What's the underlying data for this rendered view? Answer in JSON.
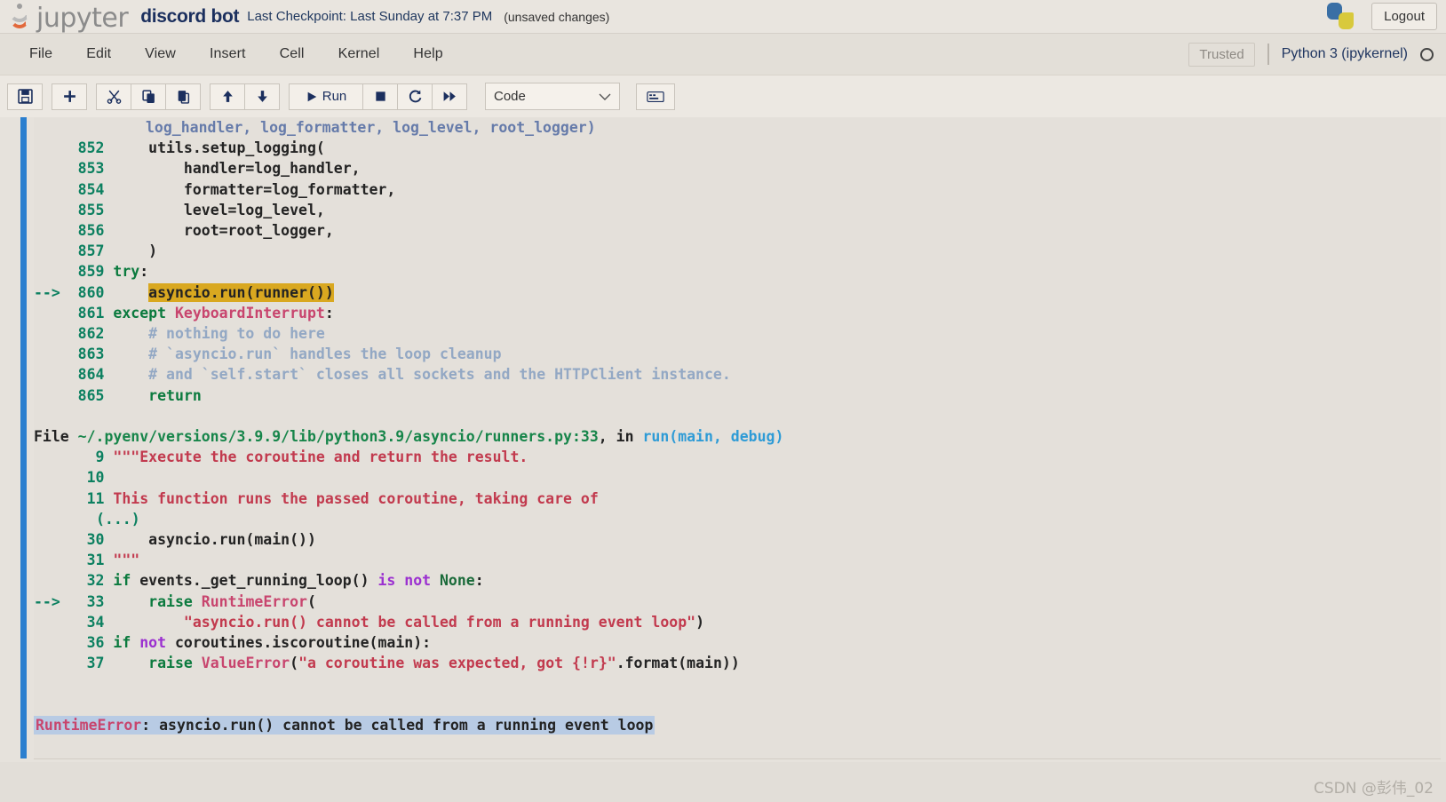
{
  "header": {
    "logo_text": "jupyter",
    "notebook_name": "discord bot",
    "checkpoint": "Last Checkpoint: Last Sunday at 7:37 PM",
    "unsaved": "(unsaved changes)",
    "logout_label": "Logout",
    "python_logo_icon": "python-logo-icon"
  },
  "menubar": {
    "items": [
      {
        "label": "File"
      },
      {
        "label": "Edit"
      },
      {
        "label": "View"
      },
      {
        "label": "Insert"
      },
      {
        "label": "Cell"
      },
      {
        "label": "Kernel"
      },
      {
        "label": "Help"
      }
    ],
    "trusted_label": "Trusted",
    "kernel_label": "Python 3 (ipykernel)",
    "kernel_status": "idle"
  },
  "toolbar": {
    "save_icon": "ὋE",
    "save_glyph": "⬜",
    "add_glyph": "+",
    "cut_glyph": "✂",
    "copy_glyph": "⧉",
    "paste_glyph": "⎘",
    "move_up_glyph": "↑",
    "move_down_glyph": "↓",
    "run_glyph": "▶",
    "run_label": "Run",
    "stop_glyph": "■",
    "restart_glyph": "↻",
    "restart_run_all_glyph": "⏩",
    "cell_type_value": "Code",
    "cell_type_caret": "∨",
    "palette_glyph": "⌨"
  },
  "output": {
    "lines": [
      {
        "type": "fade",
        "text": "log_handler, log_formatter, log_level, root_logger)"
      },
      {
        "type": "code",
        "arrow": "",
        "num": "852",
        "segments": [
          {
            "c": "plain",
            "t": "    utils.setup_logging("
          }
        ]
      },
      {
        "type": "code",
        "arrow": "",
        "num": "853",
        "segments": [
          {
            "c": "plain",
            "t": "        handler=log_handler,"
          }
        ]
      },
      {
        "type": "code",
        "arrow": "",
        "num": "854",
        "segments": [
          {
            "c": "plain",
            "t": "        formatter=log_formatter,"
          }
        ]
      },
      {
        "type": "code",
        "arrow": "",
        "num": "855",
        "segments": [
          {
            "c": "plain",
            "t": "        level=log_level,"
          }
        ]
      },
      {
        "type": "code",
        "arrow": "",
        "num": "856",
        "segments": [
          {
            "c": "plain",
            "t": "        root=root_logger,"
          }
        ]
      },
      {
        "type": "code",
        "arrow": "",
        "num": "857",
        "segments": [
          {
            "c": "plain",
            "t": "    )"
          }
        ]
      },
      {
        "type": "code",
        "arrow": "",
        "num": "859",
        "segments": [
          {
            "c": "kw",
            "t": "try"
          },
          {
            "c": "plain",
            "t": ":"
          }
        ]
      },
      {
        "type": "code",
        "arrow": "--> ",
        "num": "860",
        "highlight": true,
        "segments": [
          {
            "c": "plain",
            "t": "    "
          },
          {
            "c": "hl",
            "t": "asyncio.run(runner())"
          }
        ]
      },
      {
        "type": "code",
        "arrow": "",
        "num": "861",
        "segments": [
          {
            "c": "kw",
            "t": "except"
          },
          {
            "c": "plain",
            "t": " "
          },
          {
            "c": "exc",
            "t": "KeyboardInterrupt"
          },
          {
            "c": "plain",
            "t": ":"
          }
        ]
      },
      {
        "type": "code",
        "arrow": "",
        "num": "862",
        "segments": [
          {
            "c": "cmt",
            "t": "    # nothing to do here"
          }
        ]
      },
      {
        "type": "code",
        "arrow": "",
        "num": "863",
        "segments": [
          {
            "c": "cmt",
            "t": "    # `asyncio.run` handles the loop cleanup"
          }
        ]
      },
      {
        "type": "code",
        "arrow": "",
        "num": "864",
        "segments": [
          {
            "c": "cmt",
            "t": "    # and `self.start` closes all sockets and the HTTPClient instance."
          }
        ]
      },
      {
        "type": "code",
        "arrow": "",
        "num": "865",
        "segments": [
          {
            "c": "plain",
            "t": "    "
          },
          {
            "c": "kw",
            "t": "return"
          }
        ]
      },
      {
        "type": "blank"
      },
      {
        "type": "file",
        "segments": [
          {
            "c": "plain",
            "t": "File "
          },
          {
            "c": "path",
            "t": "~/.pyenv/versions/3.9.9/lib/python3.9/asyncio/runners.py:33"
          },
          {
            "c": "plain",
            "t": ", in "
          },
          {
            "c": "fn",
            "t": "run(main, debug)"
          }
        ]
      },
      {
        "type": "code",
        "arrow": "",
        "num": "9",
        "segments": [
          {
            "c": "str",
            "t": "\"\"\"Execute the coroutine and return the result."
          }
        ]
      },
      {
        "type": "code",
        "arrow": "",
        "num": "10",
        "segments": [
          {
            "c": "plain",
            "t": ""
          }
        ]
      },
      {
        "type": "code",
        "arrow": "",
        "num": "11",
        "segments": [
          {
            "c": "str",
            "t": "This function runs the passed coroutine, taking care of"
          }
        ]
      },
      {
        "type": "ellipsis",
        "text": "(...)"
      },
      {
        "type": "code",
        "arrow": "",
        "num": "30",
        "segments": [
          {
            "c": "plain",
            "t": "    asyncio.run(main())"
          }
        ]
      },
      {
        "type": "code",
        "arrow": "",
        "num": "31",
        "segments": [
          {
            "c": "str",
            "t": "\"\"\""
          }
        ]
      },
      {
        "type": "code",
        "arrow": "",
        "num": "32",
        "segments": [
          {
            "c": "kw",
            "t": "if"
          },
          {
            "c": "plain",
            "t": " events._get_running_loop() "
          },
          {
            "c": "op",
            "t": "is not"
          },
          {
            "c": "plain",
            "t": " "
          },
          {
            "c": "none",
            "t": "None"
          },
          {
            "c": "plain",
            "t": ":"
          }
        ]
      },
      {
        "type": "code",
        "arrow": "--> ",
        "num": "33",
        "segments": [
          {
            "c": "plain",
            "t": "    "
          },
          {
            "c": "kw",
            "t": "raise"
          },
          {
            "c": "plain",
            "t": " "
          },
          {
            "c": "exc",
            "t": "RuntimeError"
          },
          {
            "c": "plain",
            "t": "("
          }
        ]
      },
      {
        "type": "code",
        "arrow": "",
        "num": "34",
        "segments": [
          {
            "c": "plain",
            "t": "        "
          },
          {
            "c": "str",
            "t": "\"asyncio.run() cannot be called from a running event loop\""
          },
          {
            "c": "plain",
            "t": ")"
          }
        ]
      },
      {
        "type": "code",
        "arrow": "",
        "num": "36",
        "segments": [
          {
            "c": "kw",
            "t": "if"
          },
          {
            "c": "plain",
            "t": " "
          },
          {
            "c": "op",
            "t": "not"
          },
          {
            "c": "plain",
            "t": " coroutines.iscoroutine(main):"
          }
        ]
      },
      {
        "type": "code",
        "arrow": "",
        "num": "37",
        "segments": [
          {
            "c": "plain",
            "t": "    "
          },
          {
            "c": "kw",
            "t": "raise"
          },
          {
            "c": "plain",
            "t": " "
          },
          {
            "c": "exc",
            "t": "ValueError"
          },
          {
            "c": "plain",
            "t": "("
          },
          {
            "c": "str",
            "t": "\"a coroutine was expected, got {!r}\""
          },
          {
            "c": "plain",
            "t": ".format(main))"
          }
        ]
      },
      {
        "type": "blank"
      },
      {
        "type": "blank"
      },
      {
        "type": "error",
        "segments": [
          {
            "c": "exc",
            "t": "RuntimeError"
          },
          {
            "c": "plain",
            "t": ": asyncio.run() cannot be called from a running event loop"
          }
        ]
      }
    ]
  },
  "watermark": "CSDN @彭伟_02",
  "colors": {
    "cell_selected_bar": "#2b7fcf",
    "highlight": "#d9a820",
    "error_highlight": "#b8cbe4",
    "accent_blue": "#1b2f5e"
  }
}
